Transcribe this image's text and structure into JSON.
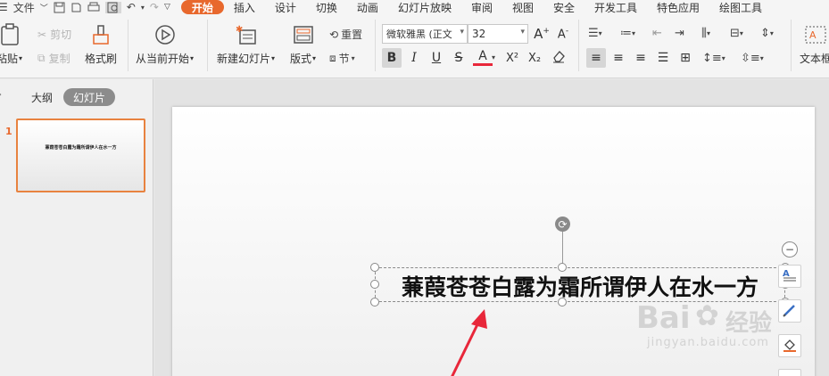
{
  "menu": {
    "file": "文件",
    "items": [
      "开始",
      "插入",
      "设计",
      "切换",
      "动画",
      "幻灯片放映",
      "审阅",
      "视图",
      "安全",
      "开发工具",
      "特色应用",
      "绘图工具"
    ],
    "active": "开始"
  },
  "ribbon": {
    "paste": "粘贴",
    "cut": "剪切",
    "copy": "复制",
    "format_painter": "格式刷",
    "from_current": "从当前开始",
    "new_slide": "新建幻灯片",
    "layout": "版式",
    "reset": "重置",
    "section": "节",
    "font_name": "微软雅黑 (正文",
    "font_size": "32",
    "bold": "B",
    "italic": "I",
    "underline": "U",
    "strike": "S",
    "font_color": "A",
    "superscript": "X²",
    "subscript": "X₂",
    "textbox_label": "文本框"
  },
  "left_pane": {
    "tab_outline": "大纲",
    "tab_slides": "幻灯片",
    "slide_number": "1",
    "thumb_text": "蒹葭苍苍白露为霜所谓伊人在水一方"
  },
  "slide": {
    "text": "蒹葭苍苍白露为霜所谓伊人在水一方"
  },
  "watermark": {
    "brand": "Bai",
    "brand2": "经验",
    "url": "jingyan.baidu.com"
  },
  "colors": {
    "accent": "#e8682d",
    "arrow": "#e8273a"
  }
}
